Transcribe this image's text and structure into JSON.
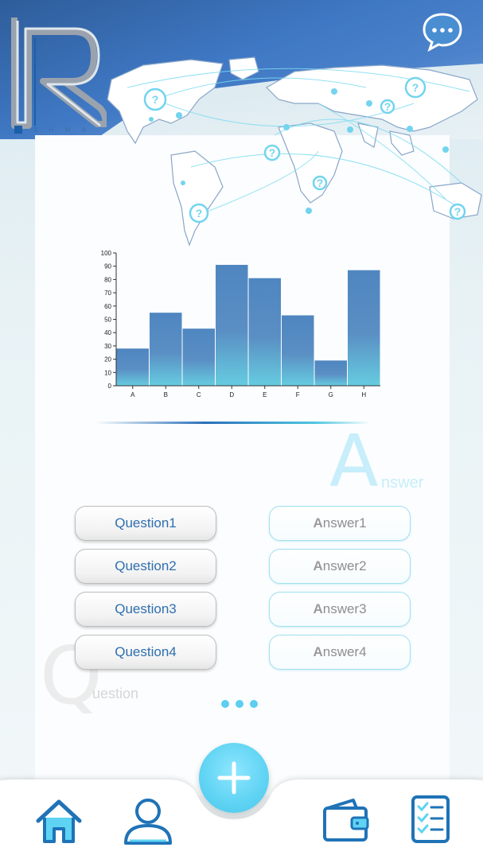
{
  "header": {
    "logo_subtitle": "S.H.M.A",
    "chat_icon": "chat-bubble-icon"
  },
  "chart_data": {
    "type": "bar",
    "categories": [
      "A",
      "B",
      "C",
      "D",
      "E",
      "F",
      "G",
      "H"
    ],
    "values": [
      28,
      55,
      43,
      91,
      81,
      53,
      19,
      87
    ],
    "ylim": [
      0,
      100
    ],
    "yticks": [
      0,
      10,
      20,
      30,
      40,
      50,
      60,
      70,
      80,
      90,
      100
    ],
    "grid": false,
    "colors": {
      "bar_top": "#4f86c0",
      "bar_bottom": "#66cce0"
    }
  },
  "watermarks": {
    "answer_letter": "A",
    "answer_rest": "nswer",
    "question_letter": "Q",
    "question_rest": "uestion"
  },
  "questions": [
    "Question1",
    "Question2",
    "Question3",
    "Question4"
  ],
  "answers": [
    {
      "first": "A",
      "rest": "nswer1"
    },
    {
      "first": "A",
      "rest": "nswer2"
    },
    {
      "first": "A",
      "rest": "nswer3"
    },
    {
      "first": "A",
      "rest": "nswer4"
    }
  ],
  "nav": {
    "items": [
      "home-icon",
      "profile-icon",
      "add-icon",
      "wallet-icon",
      "checklist-icon"
    ],
    "accent": "#1f73b7",
    "add_color": "#5fd3f3"
  }
}
